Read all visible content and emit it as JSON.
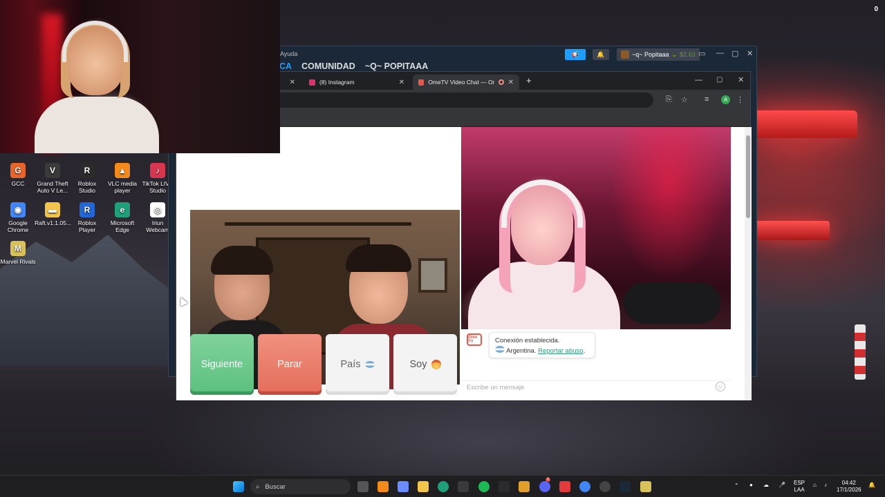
{
  "corner_counter": "0",
  "desktop_icons": [
    {
      "label": "GCC",
      "color": "#e8642a",
      "glyph": "G"
    },
    {
      "label": "Grand Theft Auto V Le...",
      "color": "#3a3a3a",
      "glyph": "V"
    },
    {
      "label": "Roblox Studio",
      "color": "#2b2b2b",
      "glyph": "R"
    },
    {
      "label": "VLC media player",
      "color": "#f28a1c",
      "glyph": "▲"
    },
    {
      "label": "TikTok LIVE Studio",
      "color": "#d8354f",
      "glyph": "♪"
    },
    {
      "label": "Google Chrome",
      "color": "#4285f4",
      "glyph": "◉"
    },
    {
      "label": "Raft.v1.1.05...",
      "color": "#f1c44c",
      "glyph": "▬"
    },
    {
      "label": "Roblox Player",
      "color": "#2366d6",
      "glyph": "R"
    },
    {
      "label": "Microsoft Edge",
      "color": "#1fa07a",
      "glyph": "e"
    },
    {
      "label": "Iriun Webcam",
      "color": "#ffffff",
      "glyph": "◎"
    },
    {
      "label": "Marvel Rivals",
      "color": "#d9c15a",
      "glyph": "M"
    }
  ],
  "steam": {
    "menu_help": "Ayuda",
    "nav": [
      "CA",
      "COMUNIDAD",
      "~Q~ POPITAAA"
    ],
    "username": "~q~ Popitaaa",
    "balance": "$2.63"
  },
  "chrome": {
    "tabs": [
      {
        "title": "",
        "active": false
      },
      {
        "title": "(8) Instagram",
        "active": false,
        "favicon_color": "#e1306c"
      },
      {
        "title": "OmeTV Video Chat — Ome",
        "active": true,
        "favicon_color": "#e45a4a"
      }
    ],
    "new_tab": "+",
    "profile_initial": "A"
  },
  "ometv": {
    "buttons": {
      "next": "Siguiente",
      "stop": "Parar",
      "country": "País",
      "gender": "Soy"
    },
    "logo_text": "Ome TV",
    "message_line1": "Conexión establecida.",
    "message_country": "Argentina.",
    "report_link": "Reportar abuso",
    "report_suffix": ".",
    "input_placeholder": "Escribe un mensaje"
  },
  "taskbar": {
    "search_label": "Buscar",
    "lang_line1": "ESP",
    "lang_line2": "LAA",
    "time": "04:42",
    "date": "17/1/2026",
    "discord_badge": "9"
  }
}
